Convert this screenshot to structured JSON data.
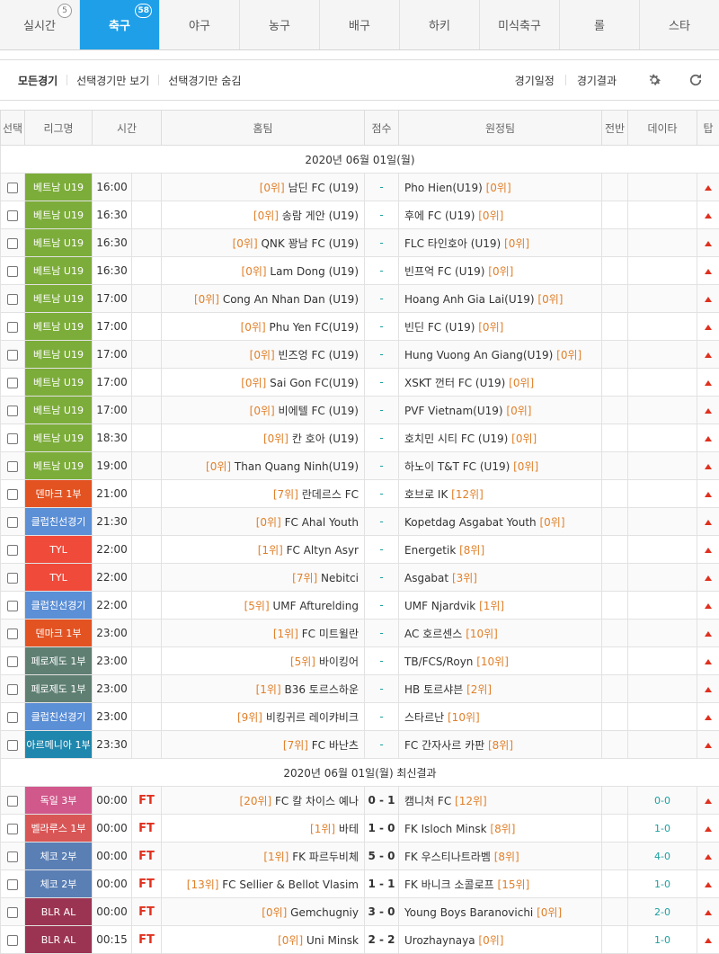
{
  "sport_tabs": [
    {
      "label": "실시간",
      "badge": "5"
    },
    {
      "label": "축구",
      "badge": "58"
    },
    {
      "label": "야구",
      "badge": ""
    },
    {
      "label": "농구",
      "badge": ""
    },
    {
      "label": "배구",
      "badge": ""
    },
    {
      "label": "하키",
      "badge": ""
    },
    {
      "label": "미식축구",
      "badge": ""
    },
    {
      "label": "롤",
      "badge": ""
    },
    {
      "label": "스타",
      "badge": ""
    }
  ],
  "filters": {
    "all": "모든경기",
    "show_selected": "선택경기만 보기",
    "hide_selected": "선택경기만 숨김",
    "schedule": "경기일정",
    "results": "경기결과"
  },
  "icons": {
    "settings": "gear-icon",
    "refresh": "refresh-icon"
  },
  "columns": [
    "선택",
    "리그명",
    "시간",
    "홈팀",
    "점수",
    "원정팀",
    "전반",
    "데이타",
    "탑"
  ],
  "colors": {
    "active_tab": "#1e9fe8",
    "league_vietnam": "#7cad3a",
    "league_denmark": "#e35322",
    "league_club": "#5b8fd6",
    "league_tyl": "#f04a3a",
    "league_faroe": "#5f7f73",
    "league_armenia": "#1f86ad",
    "league_germany": "#d1588b",
    "league_belarus": "#d95656",
    "league_czech": "#5a7fb5",
    "league_blr_al": "#9b3452",
    "live_status": "#e0301e",
    "rank_text": "#e0802a"
  },
  "date_header": "2020년 06월 01일(월)",
  "results_header": "2020년 06월 01일(월) 최신결과",
  "upcoming": [
    {
      "league": "베트남 U19",
      "color": "#7cad3a",
      "time": "16:00",
      "home_rank": "[0위]",
      "home": "남딘 FC (U19)",
      "score": "-",
      "away": "Pho Hien(U19)",
      "away_rank": "[0위]"
    },
    {
      "league": "베트남 U19",
      "color": "#7cad3a",
      "time": "16:30",
      "home_rank": "[0위]",
      "home": "송람 게안 (U19)",
      "score": "-",
      "away": "후에 FC (U19)",
      "away_rank": "[0위]"
    },
    {
      "league": "베트남 U19",
      "color": "#7cad3a",
      "time": "16:30",
      "home_rank": "[0위]",
      "home": "QNK 꽝남 FC (U19)",
      "score": "-",
      "away": "FLC 타인호아 (U19)",
      "away_rank": "[0위]"
    },
    {
      "league": "베트남 U19",
      "color": "#7cad3a",
      "time": "16:30",
      "home_rank": "[0위]",
      "home": "Lam Dong (U19)",
      "score": "-",
      "away": "빈프억 FC (U19)",
      "away_rank": "[0위]"
    },
    {
      "league": "베트남 U19",
      "color": "#7cad3a",
      "time": "17:00",
      "home_rank": "[0위]",
      "home": "Cong An Nhan Dan (U19)",
      "score": "-",
      "away": "Hoang Anh Gia Lai(U19)",
      "away_rank": "[0위]"
    },
    {
      "league": "베트남 U19",
      "color": "#7cad3a",
      "time": "17:00",
      "home_rank": "[0위]",
      "home": "Phu Yen FC(U19)",
      "score": "-",
      "away": "빈딘 FC (U19)",
      "away_rank": "[0위]"
    },
    {
      "league": "베트남 U19",
      "color": "#7cad3a",
      "time": "17:00",
      "home_rank": "[0위]",
      "home": "빈즈엉 FC (U19)",
      "score": "-",
      "away": "Hung Vuong An Giang(U19)",
      "away_rank": "[0위]"
    },
    {
      "league": "베트남 U19",
      "color": "#7cad3a",
      "time": "17:00",
      "home_rank": "[0위]",
      "home": "Sai Gon FC(U19)",
      "score": "-",
      "away": "XSKT 껀터 FC (U19)",
      "away_rank": "[0위]"
    },
    {
      "league": "베트남 U19",
      "color": "#7cad3a",
      "time": "17:00",
      "home_rank": "[0위]",
      "home": "비에텔 FC (U19)",
      "score": "-",
      "away": "PVF Vietnam(U19)",
      "away_rank": "[0위]"
    },
    {
      "league": "베트남 U19",
      "color": "#7cad3a",
      "time": "18:30",
      "home_rank": "[0위]",
      "home": "칸 호아 (U19)",
      "score": "-",
      "away": "호치민 시티 FC (U19)",
      "away_rank": "[0위]"
    },
    {
      "league": "베트남 U19",
      "color": "#7cad3a",
      "time": "19:00",
      "home_rank": "[0위]",
      "home": "Than Quang Ninh(U19)",
      "score": "-",
      "away": "하노이 T&T FC (U19)",
      "away_rank": "[0위]"
    },
    {
      "league": "덴마크 1부",
      "color": "#e35322",
      "time": "21:00",
      "home_rank": "[7위]",
      "home": "란데르스 FC",
      "score": "-",
      "away": "호브로 IK",
      "away_rank": "[12위]"
    },
    {
      "league": "클럽친선경기",
      "color": "#5b8fd6",
      "time": "21:30",
      "home_rank": "[0위]",
      "home": "FC Ahal Youth",
      "score": "-",
      "away": "Kopetdag Asgabat Youth",
      "away_rank": "[0위]"
    },
    {
      "league": "TYL",
      "color": "#f04a3a",
      "time": "22:00",
      "home_rank": "[1위]",
      "home": "FC Altyn Asyr",
      "score": "-",
      "away": "Energetik",
      "away_rank": "[8위]"
    },
    {
      "league": "TYL",
      "color": "#f04a3a",
      "time": "22:00",
      "home_rank": "[7위]",
      "home": "Nebitci",
      "score": "-",
      "away": "Asgabat",
      "away_rank": "[3위]"
    },
    {
      "league": "클럽친선경기",
      "color": "#5b8fd6",
      "time": "22:00",
      "home_rank": "[5위]",
      "home": "UMF Afturelding",
      "score": "-",
      "away": "UMF Njardvik",
      "away_rank": "[1위]"
    },
    {
      "league": "덴마크 1부",
      "color": "#e35322",
      "time": "23:00",
      "home_rank": "[1위]",
      "home": "FC 미트윌란",
      "score": "-",
      "away": "AC 호르센스",
      "away_rank": "[10위]"
    },
    {
      "league": "페로제도 1부",
      "color": "#5f7f73",
      "time": "23:00",
      "home_rank": "[5위]",
      "home": "바이킹어",
      "score": "-",
      "away": "TB/FCS/Royn",
      "away_rank": "[10위]"
    },
    {
      "league": "페로제도 1부",
      "color": "#5f7f73",
      "time": "23:00",
      "home_rank": "[1위]",
      "home": "B36 토르스하운",
      "score": "-",
      "away": "HB 토르샤븐",
      "away_rank": "[2위]"
    },
    {
      "league": "클럽친선경기",
      "color": "#5b8fd6",
      "time": "23:00",
      "home_rank": "[9위]",
      "home": "비킹귀르 레이캬비크",
      "score": "-",
      "away": "스타르난",
      "away_rank": "[10위]"
    },
    {
      "league": "아르메니아 1부",
      "color": "#1f86ad",
      "time": "23:30",
      "home_rank": "[7위]",
      "home": "FC 바난츠",
      "score": "-",
      "away": "FC 간자사르 카판",
      "away_rank": "[8위]"
    }
  ],
  "results": [
    {
      "league": "독일 3부",
      "color": "#d1588b",
      "time": "00:00",
      "status": "FT",
      "home_rank": "[20위]",
      "home": "FC 칼 차이스 예나",
      "score": "0 - 1",
      "away": "캠니처 FC",
      "away_rank": "[12위]",
      "half": "0-0"
    },
    {
      "league": "벨라루스 1부",
      "color": "#d95656",
      "time": "00:00",
      "status": "FT",
      "home_rank": "[1위]",
      "home": "바테",
      "score": "1 - 0",
      "away": "FK Isloch Minsk",
      "away_rank": "[8위]",
      "half": "1-0"
    },
    {
      "league": "체코 2부",
      "color": "#5a7fb5",
      "time": "00:00",
      "status": "FT",
      "home_rank": "[1위]",
      "home": "FK 파르두비체",
      "score": "5 - 0",
      "away": "FK 우스티나트라벰",
      "away_rank": "[8위]",
      "half": "4-0"
    },
    {
      "league": "체코 2부",
      "color": "#5a7fb5",
      "time": "00:00",
      "status": "FT",
      "home_rank": "[13위]",
      "home": "FC Sellier & Bellot Vlasim",
      "score": "1 - 1",
      "away": "FK 바니크 소콜로프",
      "away_rank": "[15위]",
      "half": "1-0"
    },
    {
      "league": "BLR AL",
      "color": "#9b3452",
      "time": "00:00",
      "status": "FT",
      "home_rank": "[0위]",
      "home": "Gemchugniy",
      "score": "3 - 0",
      "away": "Young Boys Baranovichi",
      "away_rank": "[0위]",
      "half": "2-0"
    },
    {
      "league": "BLR AL",
      "color": "#9b3452",
      "time": "00:15",
      "status": "FT",
      "home_rank": "[0위]",
      "home": "Uni Minsk",
      "score": "2 - 2",
      "away": "Urozhaynaya",
      "away_rank": "[0위]",
      "half": "1-0"
    }
  ]
}
